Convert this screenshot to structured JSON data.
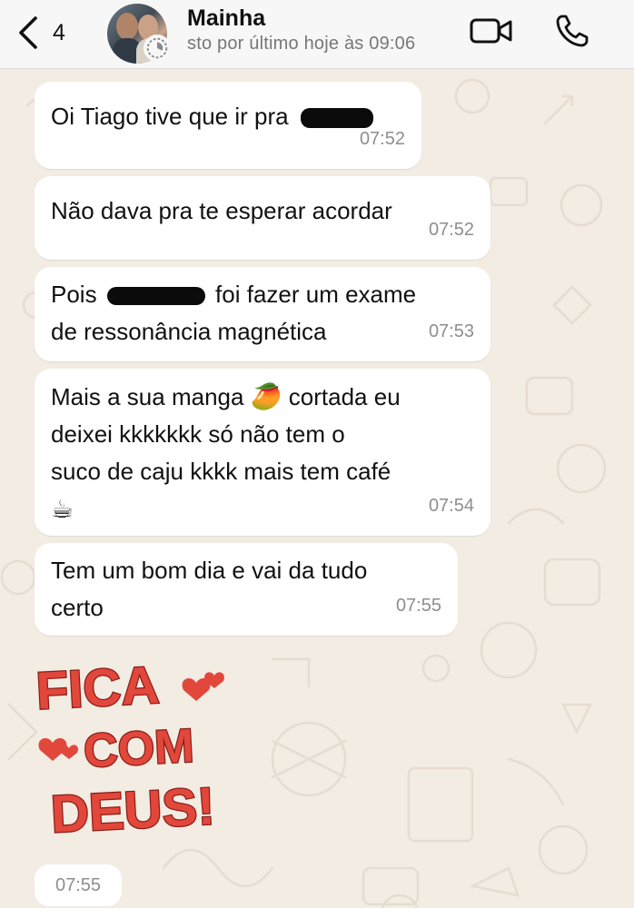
{
  "header": {
    "back_count": "4",
    "contact_name": "Mainha",
    "last_seen": "sto por último hoje às 09:06"
  },
  "messages": [
    {
      "text": "Oi Tiago tive que ir pra",
      "time": "07:52"
    },
    {
      "text": "Não dava pra te esperar acordar",
      "time": "07:52"
    },
    {
      "text_before": "Pois",
      "text_after": "foi fazer um exame",
      "line2": "de ressonância magnética",
      "time": "07:53"
    },
    {
      "line1": "Mais a sua manga",
      "emoji1": "🥭",
      "line1b": "cortada eu",
      "line2": "deixei kkkkkkk só não tem o",
      "line3": "suco de caju kkkk mais tem café",
      "emoji2": "☕",
      "time": "07:54"
    },
    {
      "line1": "Tem um bom dia e vai da tudo",
      "line2": "certo",
      "time": "07:55"
    }
  ],
  "sticker": {
    "words": [
      "FICA",
      "COM",
      "DEUS!"
    ],
    "time": "07:55"
  },
  "colors": {
    "bubble": "#ffffff",
    "wallpaper": "#f2ece3",
    "sticker_red": "#e2473c",
    "time": "#8e8e8e"
  }
}
